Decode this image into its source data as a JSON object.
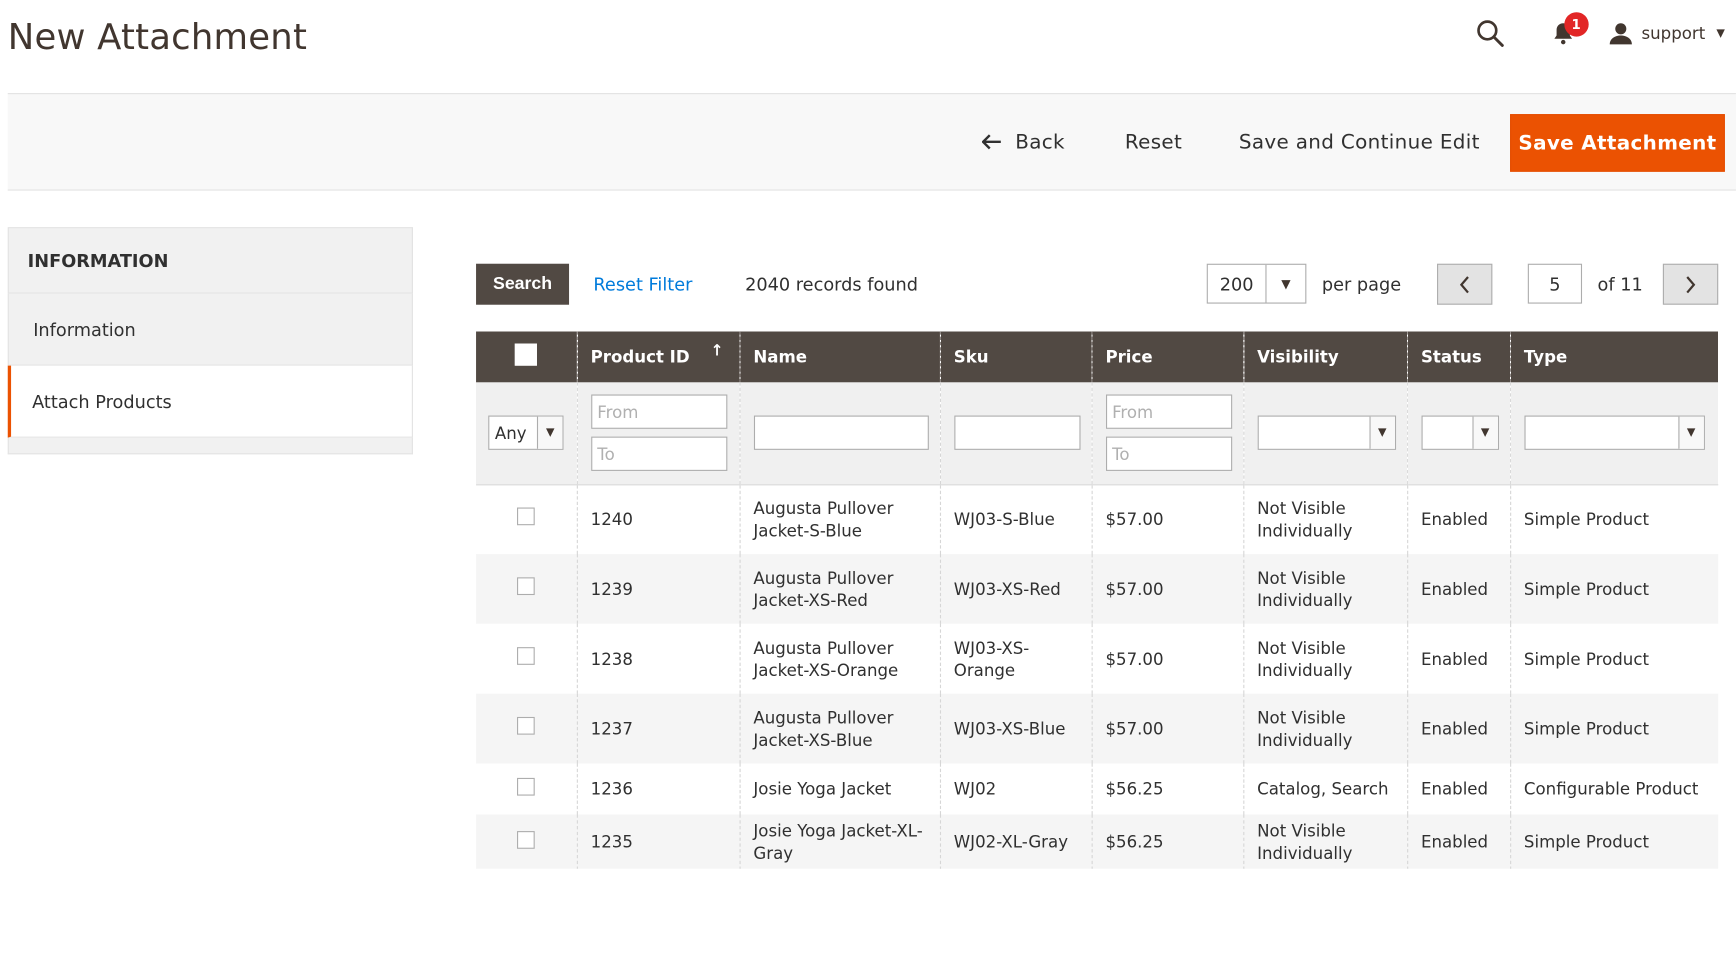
{
  "page": {
    "title": "New Attachment"
  },
  "header": {
    "notification_count": "1",
    "user_name": "support"
  },
  "actions": {
    "back": "Back",
    "reset": "Reset",
    "save_continue": "Save and Continue Edit",
    "save": "Save Attachment",
    "save_color": "#eb5202"
  },
  "sidebar": {
    "heading": "INFORMATION",
    "items": [
      {
        "label": "Information",
        "active": false
      },
      {
        "label": "Attach Products",
        "active": true
      }
    ]
  },
  "grid_tools": {
    "search": "Search",
    "reset_filter": "Reset Filter",
    "records": "2040 records found",
    "per_page_value": "200",
    "per_page_label": "per page",
    "current_page": "5",
    "total_pages": "of 11"
  },
  "columns": [
    "Product ID",
    "Name",
    "Sku",
    "Price",
    "Visibility",
    "Status",
    "Type"
  ],
  "filters": {
    "any": "Any",
    "from": "From",
    "to": "To"
  },
  "rows": [
    {
      "id": "1240",
      "name": "Augusta Pullover Jacket-S-Blue",
      "sku": "WJ03-S-Blue",
      "price": "$57.00",
      "visibility": "Not Visible Individually",
      "status": "Enabled",
      "type": "Simple Product"
    },
    {
      "id": "1239",
      "name": "Augusta Pullover Jacket-XS-Red",
      "sku": "WJ03-XS-Red",
      "price": "$57.00",
      "visibility": "Not Visible Individually",
      "status": "Enabled",
      "type": "Simple Product"
    },
    {
      "id": "1238",
      "name": "Augusta Pullover Jacket-XS-Orange",
      "sku": "WJ03-XS-Orange",
      "price": "$57.00",
      "visibility": "Not Visible Individually",
      "status": "Enabled",
      "type": "Simple Product"
    },
    {
      "id": "1237",
      "name": "Augusta Pullover Jacket-XS-Blue",
      "sku": "WJ03-XS-Blue",
      "price": "$57.00",
      "visibility": "Not Visible Individually",
      "status": "Enabled",
      "type": "Simple Product"
    },
    {
      "id": "1236",
      "name": "Josie Yoga Jacket",
      "sku": "WJ02",
      "price": "$56.25",
      "visibility": "Catalog, Search",
      "status": "Enabled",
      "type": "Configurable Product"
    },
    {
      "id": "1235",
      "name": "Josie Yoga Jacket-XL-Gray",
      "sku": "WJ02-XL-Gray",
      "price": "$56.25",
      "visibility": "Not Visible Individually",
      "status": "Enabled",
      "type": "Simple Product"
    }
  ]
}
